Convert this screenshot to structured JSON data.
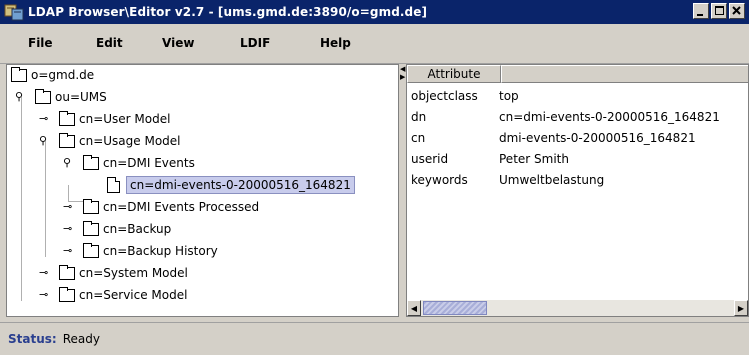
{
  "window": {
    "title": "LDAP Browser\\Editor v2.7 - [ums.gmd.de:3890/o=gmd.de]"
  },
  "menu": [
    "File",
    "Edit",
    "View",
    "LDIF",
    "Help"
  ],
  "tree": {
    "nodes": [
      {
        "label": "o=gmd.de",
        "toggle": "",
        "icon": "folder"
      },
      {
        "label": "ou=UMS",
        "toggle": "expanded",
        "icon": "folder"
      },
      {
        "label": "cn=User Model",
        "toggle": "collapsed",
        "icon": "folder"
      },
      {
        "label": "cn=Usage Model",
        "toggle": "expanded",
        "icon": "folder"
      },
      {
        "label": "cn=DMI Events",
        "toggle": "expanded",
        "icon": "folder"
      },
      {
        "label": "cn=dmi-events-0-20000516_164821",
        "toggle": "",
        "icon": "document",
        "selected": true
      },
      {
        "label": "cn=DMI Events Processed",
        "toggle": "collapsed",
        "icon": "folder"
      },
      {
        "label": "cn=Backup",
        "toggle": "collapsed",
        "icon": "folder"
      },
      {
        "label": "cn=Backup History",
        "toggle": "collapsed",
        "icon": "folder"
      },
      {
        "label": "cn=System Model",
        "toggle": "collapsed",
        "icon": "folder"
      },
      {
        "label": "cn=Service Model",
        "toggle": "collapsed",
        "icon": "folder"
      }
    ]
  },
  "attributes": {
    "header": "Attribute",
    "rows": [
      {
        "name": "objectclass",
        "value": "top"
      },
      {
        "name": "dn",
        "value": "cn=dmi-events-0-20000516_164821"
      },
      {
        "name": "cn",
        "value": "dmi-events-0-20000516_164821"
      },
      {
        "name": "userid",
        "value": "Peter Smith"
      },
      {
        "name": "keywords",
        "value": "Umweltbelastung"
      }
    ]
  },
  "status": {
    "label": "Status:",
    "value": "Ready"
  },
  "colors": {
    "titlebar": "#0a246a",
    "window_bg": "#d4d0c8",
    "selection": "#c8ccec",
    "status_label": "#2a3f8f"
  }
}
